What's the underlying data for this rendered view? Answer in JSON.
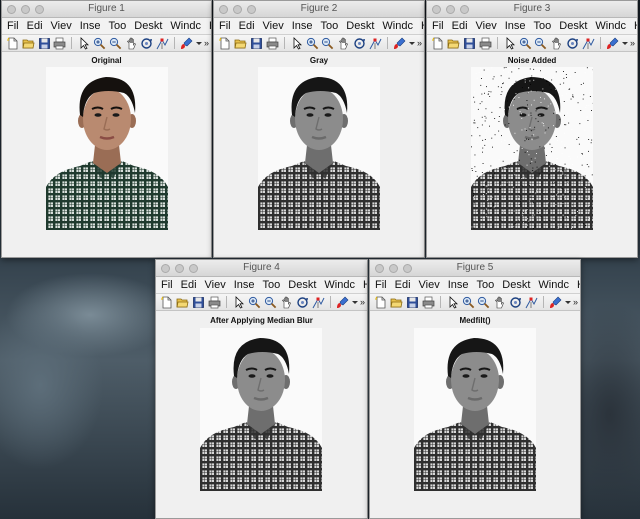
{
  "menus": [
    "File",
    "Edit",
    "View",
    "Insert",
    "Tools",
    "Desktop",
    "Window",
    "Help"
  ],
  "menu_labels_visible": [
    "Fil",
    "Edi",
    "Viev",
    "Inse",
    "Too",
    "Deskt",
    "Windc",
    "Hel"
  ],
  "menu_overflow": "▸",
  "toolbar_overflow": "»",
  "toolbar_icons": [
    "new-figure-icon",
    "open-icon",
    "save-icon",
    "print-icon",
    "pointer-icon",
    "zoom-in-icon",
    "zoom-out-icon",
    "pan-icon",
    "rotate-3d-icon",
    "data-cursor-icon",
    "brush-icon"
  ],
  "windows": [
    {
      "title": "Figure 1",
      "axes_title": "Original",
      "image": "color"
    },
    {
      "title": "Figure 2",
      "axes_title": "Gray",
      "image": "gray"
    },
    {
      "title": "Figure 3",
      "axes_title": "Noise Added",
      "image": "noise"
    },
    {
      "title": "Figure 4",
      "axes_title": "After Applying Median Blur",
      "image": "gray"
    },
    {
      "title": "Figure 5",
      "axes_title": "Medfilt()",
      "image": "gray"
    }
  ]
}
